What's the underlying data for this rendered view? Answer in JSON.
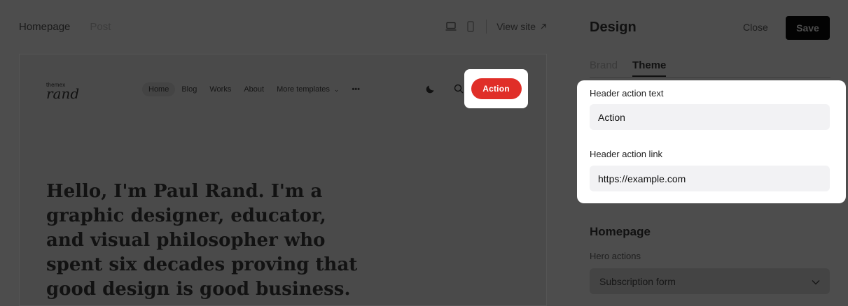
{
  "top_tabs": [
    {
      "label": "Homepage"
    },
    {
      "label": "Post"
    }
  ],
  "view_site_label": "View site",
  "preview": {
    "logo_small": "themex",
    "logo_big": "rand",
    "nav": [
      {
        "label": "Home"
      },
      {
        "label": "Blog"
      },
      {
        "label": "Works"
      },
      {
        "label": "About"
      },
      {
        "label": "More templates"
      }
    ],
    "nav_more": "•••",
    "action_label": "Action",
    "hero_text": "Hello, I'm Paul Rand. I'm a graphic designer, educator, and visual philosopher who spent six decades proving that good design is good business."
  },
  "panel": {
    "title": "Design",
    "close_label": "Close",
    "save_label": "Save",
    "tabs": [
      {
        "label": "Brand"
      },
      {
        "label": "Theme"
      }
    ],
    "header_action_text_label": "Header action text",
    "header_action_text_value": "Action",
    "header_action_link_label": "Header action link",
    "header_action_link_value": "https://example.com",
    "homepage_section_title": "Homepage",
    "hero_actions_label": "Hero actions",
    "hero_actions_selected": "Subscription form"
  },
  "colors": {
    "overlay": "#4d4d4d",
    "action_button": "#e02e28",
    "save_button": "#030303"
  }
}
